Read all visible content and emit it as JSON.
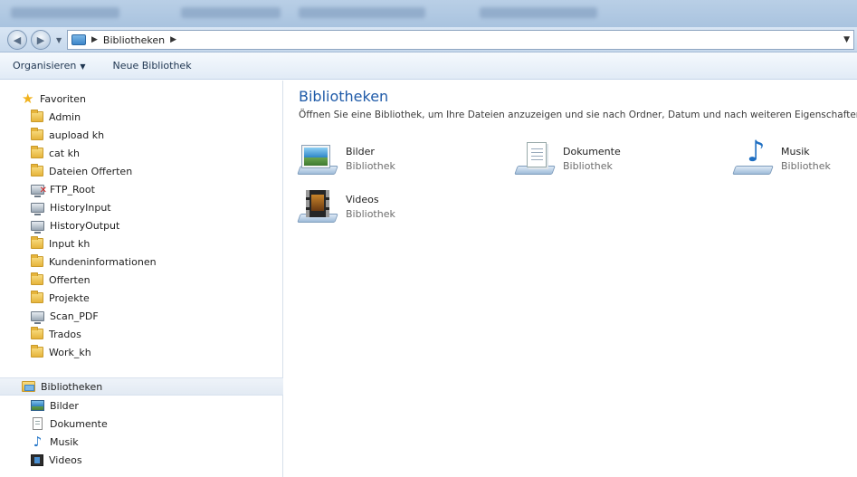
{
  "address_bar": {
    "crumb": "Bibliotheken"
  },
  "toolbar": {
    "organize_label": "Organisieren",
    "new_library_label": "Neue Bibliothek"
  },
  "nav": {
    "favorites_label": "Favoriten",
    "favorites": [
      {
        "label": "Admin",
        "icon": "folder-icon"
      },
      {
        "label": "aupload kh",
        "icon": "folder-icon"
      },
      {
        "label": "cat kh",
        "icon": "folder-icon"
      },
      {
        "label": "Dateien Offerten",
        "icon": "folder-icon"
      },
      {
        "label": "FTP_Root",
        "icon": "network-drive-disconnected-icon"
      },
      {
        "label": "HistoryInput",
        "icon": "network-drive-icon"
      },
      {
        "label": "HistoryOutput",
        "icon": "network-drive-icon"
      },
      {
        "label": "Input kh",
        "icon": "folder-icon"
      },
      {
        "label": "Kundeninformationen",
        "icon": "folder-icon"
      },
      {
        "label": "Offerten",
        "icon": "folder-icon"
      },
      {
        "label": "Projekte",
        "icon": "folder-icon"
      },
      {
        "label": "Scan_PDF",
        "icon": "network-drive-icon"
      },
      {
        "label": "Trados",
        "icon": "folder-icon"
      },
      {
        "label": "Work_kh",
        "icon": "folder-icon"
      }
    ],
    "libraries_label": "Bibliotheken",
    "libraries": [
      {
        "label": "Bilder",
        "icon": "pictures-icon"
      },
      {
        "label": "Dokumente",
        "icon": "documents-icon"
      },
      {
        "label": "Musik",
        "icon": "music-icon"
      },
      {
        "label": "Videos",
        "icon": "videos-icon"
      }
    ]
  },
  "content": {
    "title": "Bibliotheken",
    "description": "Öffnen Sie eine Bibliothek, um Ihre Dateien anzuzeigen und sie nach Ordner, Datum und nach weiteren Eigenschaften anzuc",
    "libraries": [
      {
        "name": "Bilder",
        "type": "Bibliothek",
        "icon": "pictures-library-icon"
      },
      {
        "name": "Dokumente",
        "type": "Bibliothek",
        "icon": "documents-library-icon"
      },
      {
        "name": "Musik",
        "type": "Bibliothek",
        "icon": "music-library-icon"
      },
      {
        "name": "Videos",
        "type": "Bibliothek",
        "icon": "videos-library-icon"
      }
    ]
  }
}
